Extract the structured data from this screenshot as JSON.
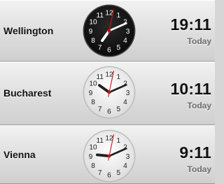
{
  "colors": {
    "dark_face": "#0b0b0b",
    "light_face": "#f4f4f4",
    "second_hand": "#d01010"
  },
  "clocks": [
    {
      "city": "Wellington",
      "time": "19:11",
      "day": "Today",
      "face": "dark",
      "hour": 7,
      "minute": 11,
      "second": 2
    },
    {
      "city": "Bucharest",
      "time": "10:11",
      "day": "Today",
      "face": "light",
      "hour": 10,
      "minute": 11,
      "second": 2
    },
    {
      "city": "Vienna",
      "time": "9:11",
      "day": "Today",
      "face": "light",
      "hour": 9,
      "minute": 11,
      "second": 2
    }
  ],
  "dial_numbers": [
    "12",
    "1",
    "2",
    "3",
    "4",
    "5",
    "6",
    "7",
    "8",
    "9",
    "10",
    "11"
  ]
}
